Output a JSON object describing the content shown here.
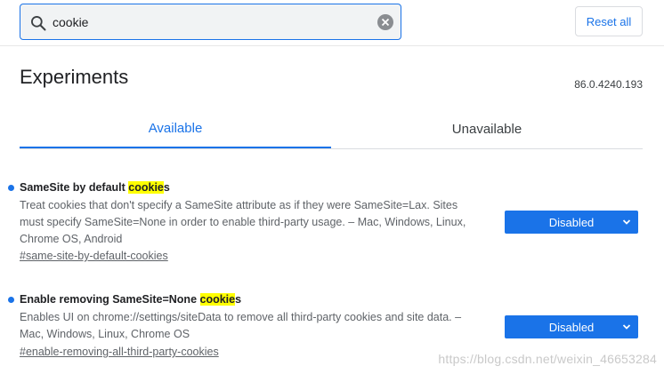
{
  "search": {
    "value": "cookie"
  },
  "header": {
    "reset_label": "Reset all"
  },
  "page": {
    "title": "Experiments",
    "version": "86.0.4240.193"
  },
  "tabs": [
    {
      "label": "Available",
      "active": true
    },
    {
      "label": "Unavailable",
      "active": false
    }
  ],
  "experiments": [
    {
      "title_pre": "SameSite by default ",
      "title_match": "cookie",
      "title_post": "s",
      "description": "Treat cookies that don't specify a SameSite attribute as if they were SameSite=Lax. Sites must specify SameSite=None in order to enable third-party usage. – Mac, Windows, Linux, Chrome OS, Android",
      "link": "#same-site-by-default-cookies",
      "state": "Disabled"
    },
    {
      "title_pre": "Enable removing SameSite=None ",
      "title_match": "cookie",
      "title_post": "s",
      "description": "Enables UI on chrome://settings/siteData to remove all third-party cookies and site data. – Mac, Windows, Linux, Chrome OS",
      "link": "#enable-removing-all-third-party-cookies",
      "state": "Disabled"
    }
  ],
  "watermark": "https://blog.csdn.net/weixin_46653284",
  "colors": {
    "accent": "#1a73e8",
    "highlight": "#ffff00"
  }
}
